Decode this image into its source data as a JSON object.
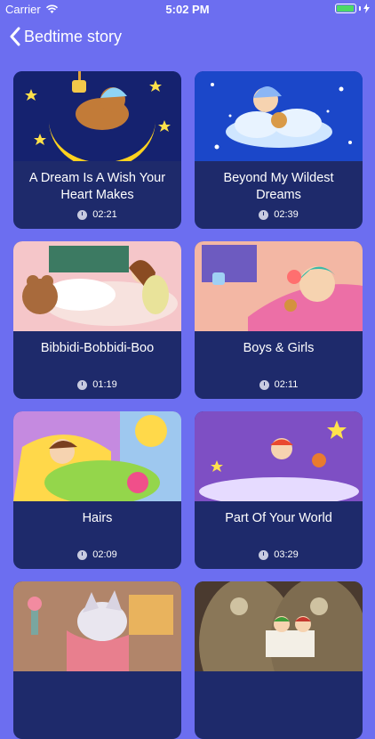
{
  "status": {
    "carrier": "Carrier",
    "time": "5:02 PM",
    "battery_level": 0.95
  },
  "nav": {
    "title": "Bedtime story"
  },
  "stories": [
    {
      "title": "A Dream Is A Wish Your Heart Makes",
      "duration": "02:21"
    },
    {
      "title": "Beyond My Wildest Dreams",
      "duration": "02:39"
    },
    {
      "title": "Bibbidi-Bobbidi-Boo",
      "duration": "01:19"
    },
    {
      "title": "Boys & Girls",
      "duration": "02:11"
    },
    {
      "title": "Hairs",
      "duration": "02:09"
    },
    {
      "title": "Part Of Your World",
      "duration": "03:29"
    },
    {
      "title": "",
      "duration": ""
    },
    {
      "title": "",
      "duration": ""
    }
  ],
  "colors": {
    "background": "#6c6ef0",
    "card": "#1e2a6b",
    "battery": "#4cd964"
  }
}
